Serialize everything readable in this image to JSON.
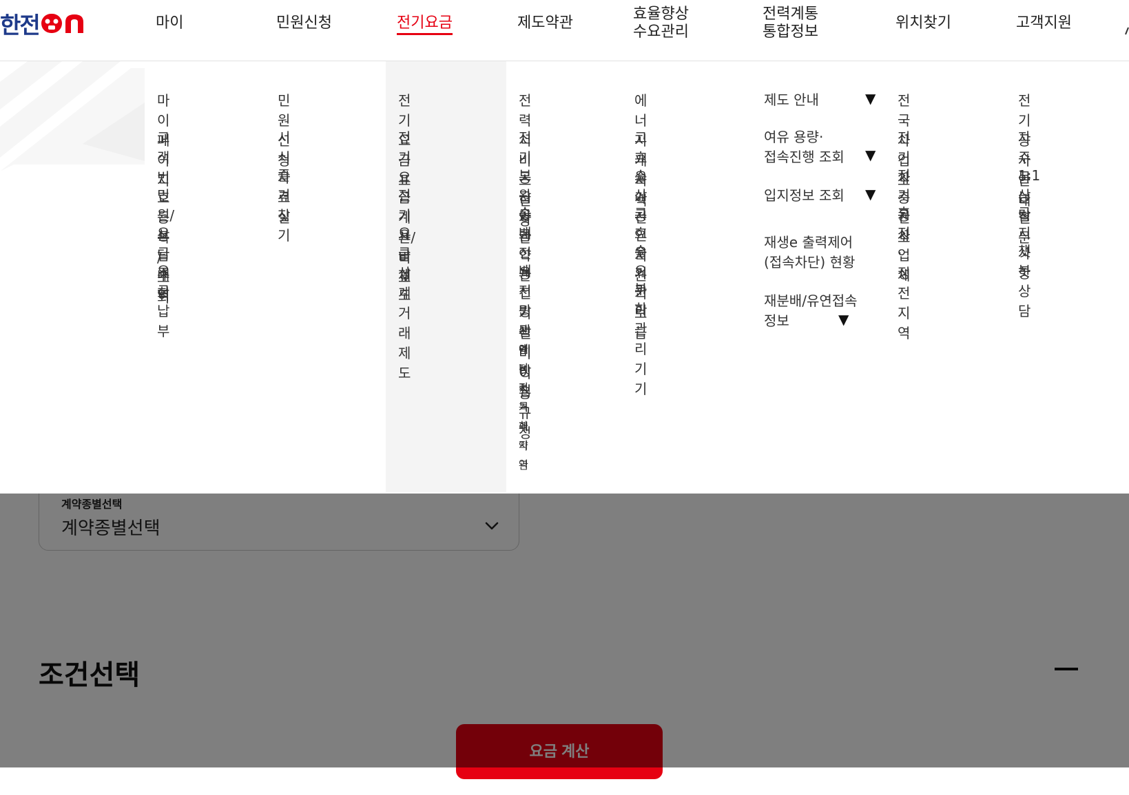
{
  "header": {
    "logo": {
      "text": "한전",
      "suffix": "ON"
    },
    "nav": [
      {
        "label": "마이"
      },
      {
        "label": "민원신청"
      },
      {
        "label": "전기요금"
      },
      {
        "label": "제도약관"
      },
      {
        "label": "효율향상\n수요관리"
      },
      {
        "label": "전력계통\n통합정보"
      },
      {
        "label": "위치찾기"
      },
      {
        "label": "고객지원"
      }
    ],
    "active_index": 2
  },
  "mega_menu": {
    "col1": [
      "마이페이지",
      "고객번호\n등록 / 조회",
      "민원/상담내역",
      "요금조회",
      "요금납부"
    ],
    "col2": [
      "민원신청",
      "서식자료실",
      "즐겨찾기"
    ],
    "col3": [
      "전기요금표",
      "전기요금계산/\n비교",
      "전기요금제도",
      "요금 상계거래\n제도"
    ],
    "col4": [
      "전력서비스헌장",
      "전기공급약관",
      "보완공급약관",
      "송배전용 전기\n설비 이용규정",
      "배전망관리방침",
      "분산에너지 특화지역",
      "보완전력거래약관"
    ],
    "col5": [
      "에너지캐시백",
      "고효율가전",
      "소상공인지원",
      "고효율기기보급",
      "수요관리",
      "부하관리기기"
    ],
    "col6": [
      "제도 안내",
      "여유 용량·\n접속진행 조회",
      "입지정보 조회",
      "재생e 출력제어\n(접속차단) 현황",
      "재분배/유연접속\n정보"
    ],
    "col6_arrow": "▼",
    "col7": [
      "전국 사업소",
      "전기차 충전소",
      "전기공사업체",
      "휴전·정전지역"
    ],
    "col8": [
      "전기공사안내",
      "자주 묻는 질문",
      "1:1상담",
      "공지사항",
      "챗봇상담"
    ]
  },
  "form": {
    "contract_select": {
      "label": "계약종별선택",
      "value": "계약종별선택"
    },
    "section_title": "조건선택",
    "calc_button": "요금 계산"
  },
  "colors": {
    "brand_blue": "#1e3a8a",
    "brand_red": "#e60012",
    "menu_highlight": "#f4f4f4"
  }
}
